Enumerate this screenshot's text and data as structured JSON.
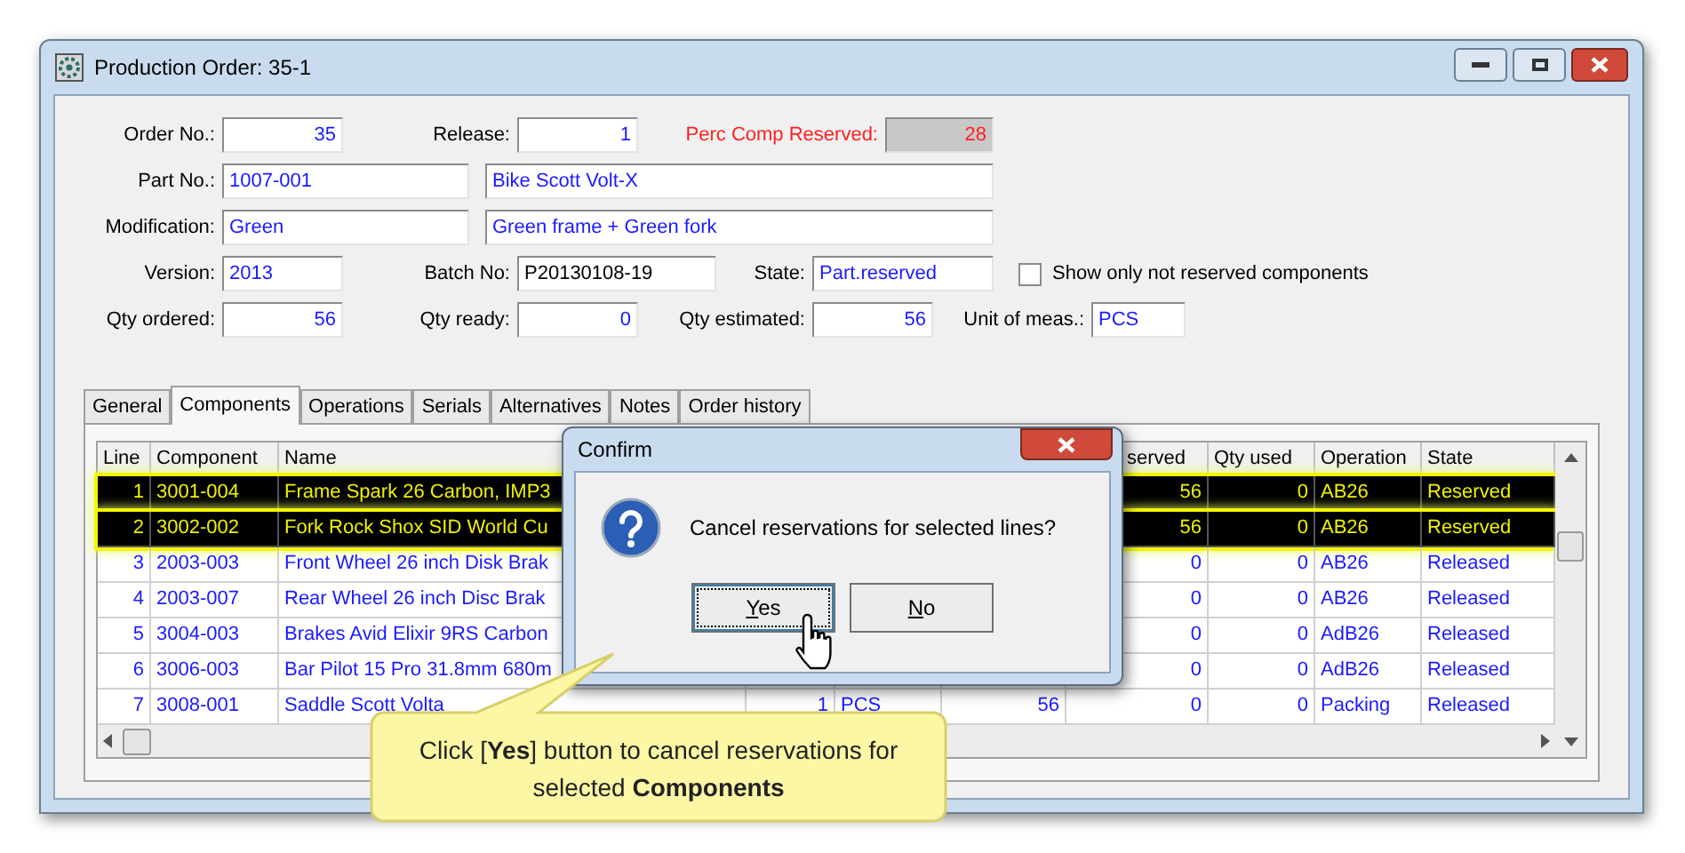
{
  "window": {
    "title": "Production Order: 35-1"
  },
  "form": {
    "order_no": {
      "label": "Order No.:",
      "value": "35"
    },
    "release": {
      "label": "Release:",
      "value": "1"
    },
    "perc_comp_reserved": {
      "label": "Perc Comp Reserved:",
      "value": "28",
      "read_only": true
    },
    "part_no": {
      "label": "Part No.:",
      "value": "1007-001",
      "description": "Bike Scott Volt-X"
    },
    "modification": {
      "label": "Modification:",
      "value": "Green",
      "description": "Green frame + Green fork"
    },
    "version": {
      "label": "Version:",
      "value": "2013"
    },
    "batch_no": {
      "label": "Batch No:",
      "value": "P20130108-19"
    },
    "state": {
      "label": "State:",
      "value": "Part.reserved"
    },
    "show_only_not_reserved": {
      "label": "Show only not reserved components",
      "checked": false
    },
    "qty_ordered": {
      "label": "Qty ordered:",
      "value": "56"
    },
    "qty_ready": {
      "label": "Qty ready:",
      "value": "0"
    },
    "qty_estimated": {
      "label": "Qty estimated:",
      "value": "56"
    },
    "unit_of_meas": {
      "label": "Unit of meas.:",
      "value": "PCS"
    }
  },
  "tabs": [
    {
      "label": "General",
      "selected": false
    },
    {
      "label": "Components",
      "selected": true
    },
    {
      "label": "Operations",
      "selected": false
    },
    {
      "label": "Serials",
      "selected": false
    },
    {
      "label": "Alternatives",
      "selected": false
    },
    {
      "label": "Notes",
      "selected": false
    },
    {
      "label": "Order history",
      "selected": false
    }
  ],
  "table": {
    "columns": {
      "line": "Line",
      "component": "Component",
      "name": "Name",
      "qty_reserved": "served",
      "qty_used": "Qty used",
      "operation": "Operation",
      "state": "State"
    },
    "rows": [
      {
        "selected": true,
        "line": "1",
        "component": "3001-004",
        "name": "Frame Spark 26 Carbon, IMP3",
        "qty_reserved": "56",
        "qty_used": "0",
        "operation": "AB26",
        "state": "Reserved"
      },
      {
        "selected": true,
        "line": "2",
        "component": "3002-002",
        "name": "Fork Rock Shox SID World Cu",
        "qty_reserved": "56",
        "qty_used": "0",
        "operation": "AB26",
        "state": "Reserved"
      },
      {
        "selected": false,
        "line": "3",
        "component": "2003-003",
        "name": "Front Wheel 26 inch Disk Brak",
        "qty_reserved": "0",
        "qty_used": "0",
        "operation": "AB26",
        "state": "Released"
      },
      {
        "selected": false,
        "line": "4",
        "component": "2003-007",
        "name": "Rear Wheel 26 inch Disc Brak",
        "qty_reserved": "0",
        "qty_used": "0",
        "operation": "AB26",
        "state": "Released"
      },
      {
        "selected": false,
        "line": "5",
        "component": "3004-003",
        "name": "Brakes Avid Elixir 9RS Carbon",
        "qty_reserved": "0",
        "qty_used": "0",
        "operation": "AdB26",
        "state": "Released"
      },
      {
        "selected": false,
        "line": "6",
        "component": "3006-003",
        "name": "Bar Pilot 15 Pro 31.8mm 680m",
        "qty_reserved": "0",
        "qty_used": "0",
        "operation": "AdB26",
        "state": "Released"
      },
      {
        "selected": false,
        "line": "7",
        "component": "3008-001",
        "name": "Saddle Scott Volta",
        "column_4": "1",
        "column_5": "PCS",
        "column_6": "56",
        "qty_reserved": "0",
        "qty_used": "0",
        "operation": "Packing",
        "state": "Released"
      }
    ]
  },
  "dialog": {
    "title": "Confirm",
    "message": "Cancel reservations for selected lines?",
    "buttons": [
      {
        "label": "Yes",
        "focused": true
      },
      {
        "label": "No",
        "focused": false
      }
    ]
  },
  "callout": {
    "text": "Click [**Yes**] button to cancel reservations for selected **Components**"
  }
}
